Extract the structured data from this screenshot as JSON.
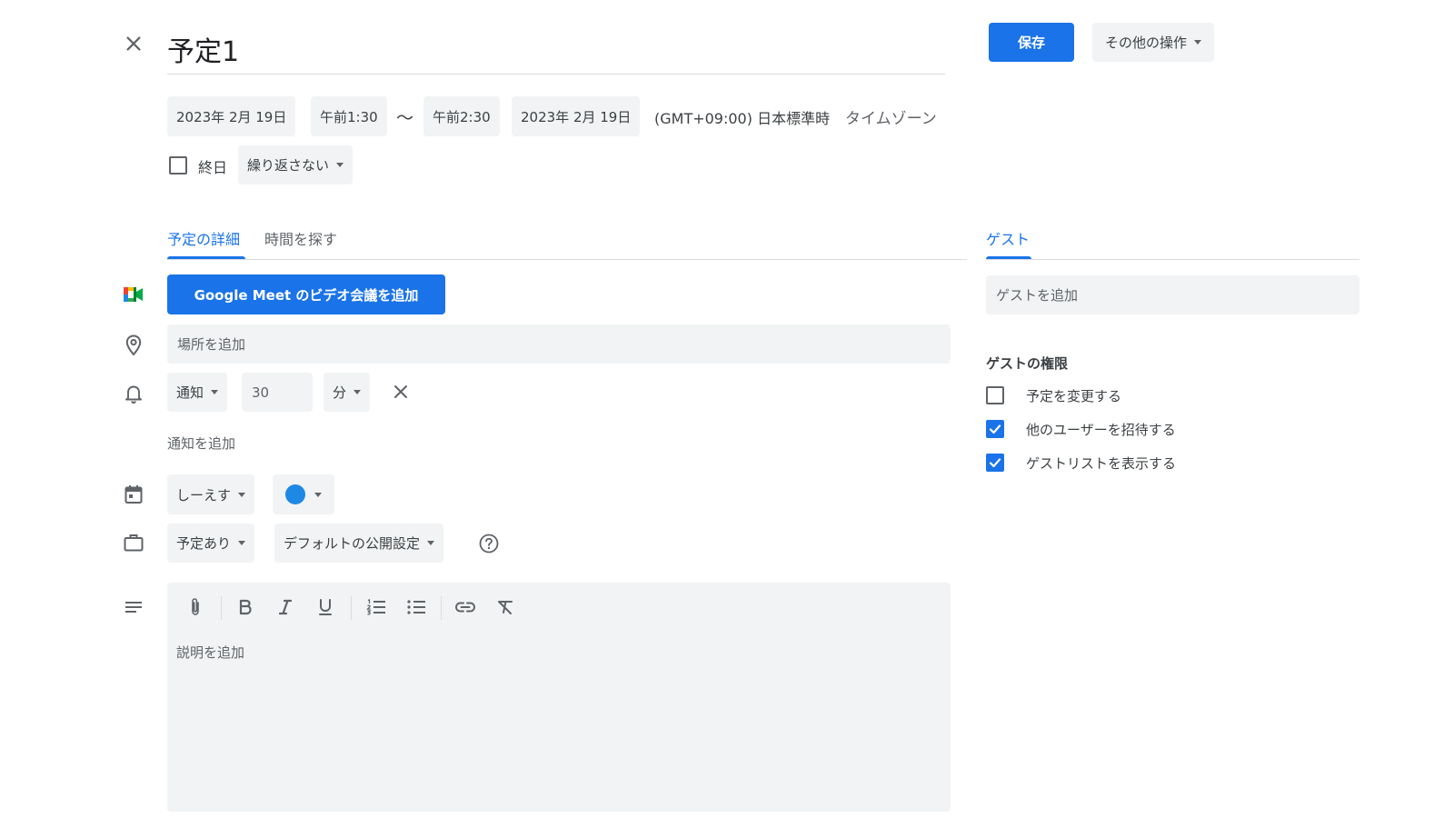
{
  "header": {
    "title": "予定1",
    "save_label": "保存",
    "more_actions_label": "その他の操作"
  },
  "datetime": {
    "start_date": "2023年 2月 19日",
    "start_time": "午前1:30",
    "separator": "～",
    "end_time": "午前2:30",
    "end_date": "2023年 2月 19日",
    "timezone": "(GMT+09:00) 日本標準時",
    "timezone_link": "タイムゾーン",
    "all_day_label": "終日",
    "all_day_checked": false,
    "repeat_label": "繰り返さない"
  },
  "tabs": {
    "details": "予定の詳細",
    "find_time": "時間を探す",
    "guests": "ゲスト"
  },
  "details": {
    "meet_button": "Google Meet のビデオ会議を追加",
    "location_placeholder": "場所を追加",
    "notification": {
      "type": "通知",
      "value": "30",
      "unit": "分"
    },
    "add_notification": "通知を追加",
    "calendar_name": "しーえす",
    "calendar_color": "#1e88e5",
    "availability": "予定あり",
    "visibility": "デフォルトの公開設定",
    "description_placeholder": "説明を追加"
  },
  "guests": {
    "add_placeholder": "ゲストを追加",
    "permissions_title": "ゲストの権限",
    "permissions": [
      {
        "label": "予定を変更する",
        "checked": false
      },
      {
        "label": "他のユーザーを招待する",
        "checked": true
      },
      {
        "label": "ゲストリストを表示する",
        "checked": true
      }
    ]
  },
  "icons": {
    "close": "close-icon",
    "meet": "google-meet-icon",
    "location": "location-pin-icon",
    "bell": "bell-icon",
    "calendar": "calendar-icon",
    "briefcase": "briefcase-icon",
    "help": "help-circle-icon",
    "description": "notes-icon",
    "toolbar": [
      "attach-icon",
      "bold-icon",
      "italic-icon",
      "underline-icon",
      "numbered-list-icon",
      "bulleted-list-icon",
      "link-icon",
      "clear-format-icon"
    ]
  },
  "colors": {
    "accent": "#1a73e8",
    "chip_bg": "#f1f3f4"
  }
}
